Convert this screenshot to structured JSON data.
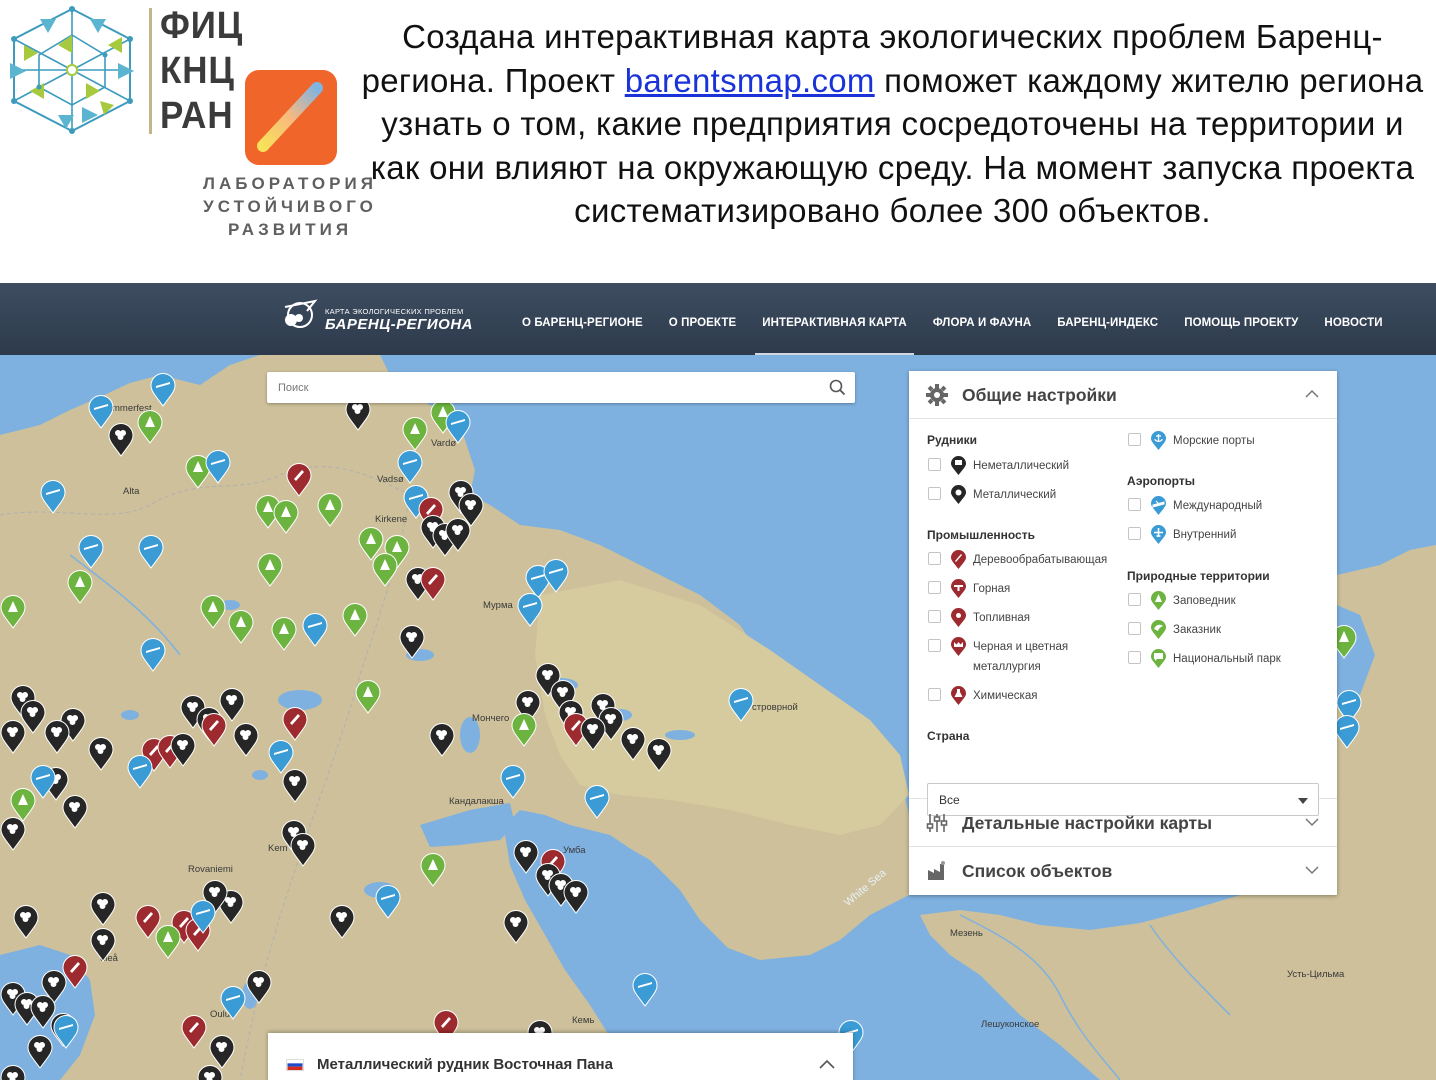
{
  "org": {
    "lines": [
      "ФИЦ",
      "КНЦ",
      "РАН"
    ],
    "lab_caption": [
      "ЛАБОРАТОРИЯ",
      "УСТОЙЧИВОГО",
      "РАЗВИТИЯ"
    ]
  },
  "headline": {
    "before_link": "Создана интерактивная карта экологических проблем Баренц-региона. Проект ",
    "link": "barentsmap.com",
    "after_link": " поможет каждому жителю региона узнать о том, какие предприятия сосредоточены на территории и как они влияют на окружающую среду. На момент запуска проекта систематизировано более 300 объектов."
  },
  "site": {
    "logo_small": "КАРТА ЭКОЛОГИЧЕСКИХ ПРОБЛЕМ",
    "logo_big": "БАРЕНЦ-РЕГИОНА",
    "nav": [
      "О БАРЕНЦ-РЕГИОНЕ",
      "О ПРОЕКТЕ",
      "ИНТЕРАКТИВНАЯ КАРТА",
      "ФЛОРА И ФАУНА",
      "БАРЕНЦ-ИНДЕКС",
      "ПОМОЩЬ ПРОЕКТУ",
      "НОВОСТИ"
    ],
    "nav_active": "ИНТЕРАКТИВНАЯ КАРТА"
  },
  "search": {
    "placeholder": "Поиск"
  },
  "panel": {
    "general_title": "Общие настройки",
    "mines_title": "Рудники",
    "mines": [
      "Неметаллический",
      "Металлический"
    ],
    "industry_title": "Промышленность",
    "industry": [
      "Деревообрабатывающая",
      "Горная",
      "Топливная",
      "Черная и цветная",
      "металлургия",
      "Химическая"
    ],
    "ports_label": "Морские порты",
    "airports_title": "Аэропорты",
    "airports": [
      "Международный",
      "Внутренний"
    ],
    "nature_title": "Природные территории",
    "nature": [
      "Заповедник",
      "Заказник",
      "Национальный парк"
    ],
    "country_title": "Страна",
    "country_value": "Все",
    "detail_title": "Детальные настройки карты",
    "list_title": "Список объектов"
  },
  "map_places": [
    "mmerfest",
    "Vardø",
    "Alta",
    "Vadsø",
    "Kirkene",
    "Мурма",
    "Мончего",
    "строврной",
    "Кандалакша",
    "Умба",
    "Kem",
    "Rovaniemi",
    "uleå",
    "Oulu",
    "Кемь",
    "Мезень",
    "Усть-Цильма",
    "Лешуконское",
    "White Sea"
  ],
  "info_bar": {
    "title": "Металлический рудник Восточная Пана"
  },
  "colors": {
    "header": "#2f3c4e",
    "sea": "#7fb1e0",
    "land": "#cdc09a",
    "pin_black": "#262626",
    "pin_red": "#9c2a2e",
    "pin_green": "#6cb33f",
    "pin_blue": "#3a9bd5",
    "logo_orange": "#f0652a"
  }
}
